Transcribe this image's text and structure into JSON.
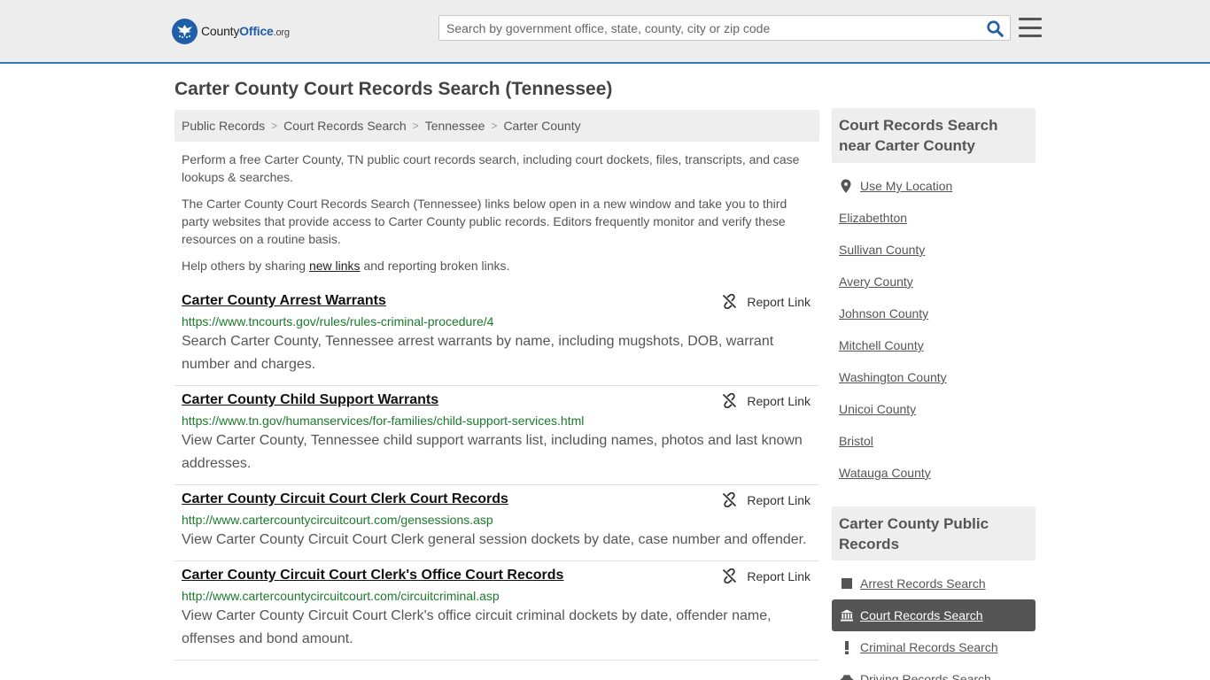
{
  "header": {
    "logo_main": "County",
    "logo_bold": "Office",
    "logo_tld": ".org",
    "search_placeholder": "Search by government office, state, county, city or zip code"
  },
  "page_title": "Carter County Court Records Search (Tennessee)",
  "breadcrumb": [
    "Public Records",
    "Court Records Search",
    "Tennessee",
    "Carter County"
  ],
  "intro": {
    "p1": "Perform a free Carter County, TN public court records search, including court dockets, files, transcripts, and case lookups & searches.",
    "p2": "The Carter County Court Records Search (Tennessee) links below open in a new window and take you to third party websites that provide access to Carter County public records. Editors frequently monitor and verify these resources on a routine basis.",
    "p3_before": "Help others by sharing ",
    "p3_link": "new links",
    "p3_after": " and reporting broken links."
  },
  "report_label": "Report Link",
  "listings": [
    {
      "title": "Carter County Arrest Warrants",
      "url": "https://www.tncourts.gov/rules/rules-criminal-procedure/4",
      "desc": "Search Carter County, Tennessee arrest warrants by name, including mugshots, DOB, warrant number and charges."
    },
    {
      "title": "Carter County Child Support Warrants",
      "url": "https://www.tn.gov/humanservices/for-families/child-support-services.html",
      "desc": "View Carter County, Tennessee child support warrants list, including names, photos and last known addresses."
    },
    {
      "title": "Carter County Circuit Court Clerk Court Records",
      "url": "http://www.cartercountycircuitcourt.com/gensessions.asp",
      "desc": "View Carter County Circuit Court Clerk general session dockets by date, case number and offender."
    },
    {
      "title": "Carter County Circuit Court Clerk's Office Court Records",
      "url": "http://www.cartercountycircuitcourt.com/circuitcriminal.asp",
      "desc": "View Carter County Circuit Court Clerk's office circuit criminal dockets by date, offender name, offenses and bond amount."
    }
  ],
  "sidebar": {
    "nearby_title": "Court Records Search near Carter County",
    "use_location": "Use My Location",
    "nearby": [
      "Elizabethton",
      "Sullivan County",
      "Avery County",
      "Johnson County",
      "Mitchell County",
      "Washington County",
      "Unicoi County",
      "Bristol",
      "Watauga County"
    ],
    "public_title": "Carter County Public Records",
    "public_records": [
      {
        "label": "Arrest Records Search",
        "icon": "square-icon",
        "active": false
      },
      {
        "label": "Court Records Search",
        "icon": "courthouse-icon",
        "active": true
      },
      {
        "label": "Criminal Records Search",
        "icon": "exclamation-icon",
        "active": false
      },
      {
        "label": "Driving Records Search",
        "icon": "car-icon",
        "active": false
      }
    ]
  },
  "colors": {
    "brand_blue": "#1f5ea8",
    "url_green": "#1a7a2a",
    "active_bg": "#555555"
  }
}
